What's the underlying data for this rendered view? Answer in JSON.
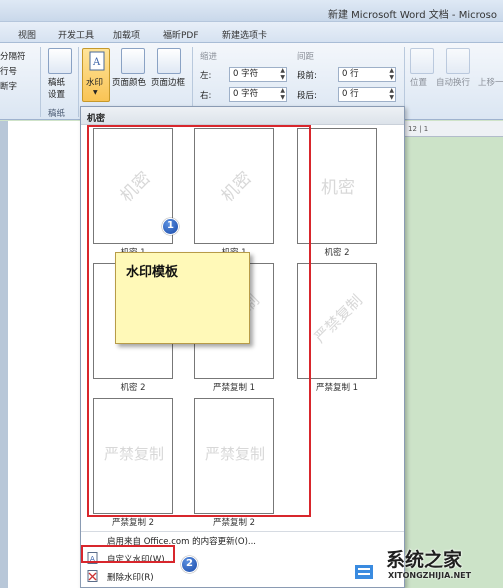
{
  "window": {
    "title": "新建 Microsoft Word 文档 - Microso"
  },
  "tabs": [
    "视图",
    "开发工具",
    "加载项",
    "福昕PDF",
    "新建选项卡"
  ],
  "ribbon": {
    "left_items": [
      "分隔符",
      "行号",
      "断字"
    ],
    "stationery": {
      "line1": "稿纸",
      "line2": "设置",
      "group": "稿纸"
    },
    "watermark_label": "水印",
    "page_color_label": "页面颜色",
    "page_border_label": "页面边框",
    "indent": {
      "heading": "缩进",
      "left_label": "左:",
      "right_label": "右:",
      "left_value": "0 字符",
      "right_value": "0 字符"
    },
    "spacing": {
      "heading": "间距",
      "before_label": "段前:",
      "after_label": "段后:",
      "before_value": "0 行",
      "after_value": "0 行"
    },
    "position_label": "位置",
    "wrap_label": "自动换行",
    "bring_label": "上移一"
  },
  "ruler_text": "12 | 1",
  "watermark_menu": {
    "header": "机密",
    "items": [
      {
        "text": "机密",
        "label": "机密 1",
        "style": "diag"
      },
      {
        "text": "机密",
        "label": "机密 1",
        "style": "diag"
      },
      {
        "text": "机密",
        "label": "机密 2",
        "style": "horiz"
      },
      {
        "text": "机密",
        "label": "机密 2",
        "style": "horiz"
      },
      {
        "text": "严禁复制",
        "label": "严禁复制 1",
        "style": "diag"
      },
      {
        "text": "严禁复制",
        "label": "严禁复制 1",
        "style": "diag"
      },
      {
        "text": "严禁复制",
        "label": "严禁复制 2",
        "style": "horiz"
      },
      {
        "text": "严禁复制",
        "label": "严禁复制 2",
        "style": "horiz"
      }
    ],
    "more_online": "启用来自 Office.com 的内容更新(O)...",
    "custom": "自定义水印(W)...",
    "remove": "删除水印(R)"
  },
  "annotations": {
    "badge1": "1",
    "badge2": "2",
    "callout": "水印模板"
  },
  "site_logo": {
    "name": "系统之家",
    "url": "XITONGZHIJIA.NET"
  }
}
